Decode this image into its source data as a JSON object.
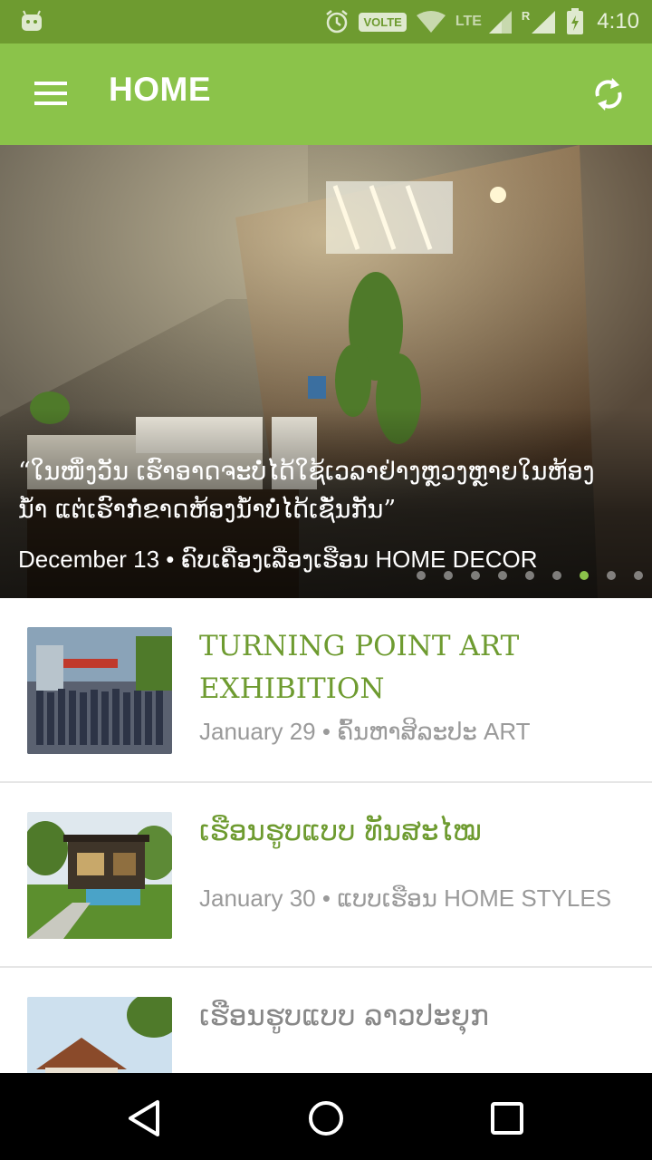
{
  "status_bar": {
    "time": "4:10",
    "volte_label": "VOLTE",
    "network_label": "LTE",
    "roaming_label": "R",
    "icons": [
      "android-icon",
      "alarm-icon",
      "wifi-icon",
      "signal-icon",
      "battery-charging-icon"
    ]
  },
  "app_bar": {
    "title": "HOME",
    "menu_icon": "hamburger-menu-icon",
    "refresh_icon": "refresh-icon",
    "color": "#8bc34a"
  },
  "hero": {
    "quote_line1": "“ໃນໜຶ່ງວັນ ເຮົາອາດຈະບໍ່ໄດ້ໃຊ້ເວລາຢ່າງຫຼວງຫຼາຍໃນຫ້ອງ",
    "quote_line2": "ນ້ຳ ແຕ່ເຮົາກໍ່ຂາດຫ້ອງນ້ຳບໍ່ໄດ້ເຊັ່ນກັນ”",
    "meta": "December 13 • ຄົບເຄື່ອງເລື່ອງເຮືອນ HOME DECOR",
    "dots_total": 9,
    "dots_active_index": 6
  },
  "articles": [
    {
      "title": "TURNING POINT ART EXHIBITION",
      "meta": "January 29 • ຄົ້ນຫາສິລະປະ ART"
    },
    {
      "title": "ເຮືອນຮູບແບບ ທັນສະໄໝ",
      "meta": "January 30 • ແບບເຮືອນ HOME STYLES"
    },
    {
      "title": "ເຮືອນຮູບແບບ ລາວປະຍຸກ",
      "meta": ""
    }
  ],
  "nav_bar": {
    "buttons": [
      "back-icon",
      "home-icon",
      "recents-icon"
    ]
  },
  "colors": {
    "status_bar": "#6e9b30",
    "accent": "#8bc34a",
    "title_text": "#6e9b30",
    "meta_text": "#9a9a9a"
  }
}
